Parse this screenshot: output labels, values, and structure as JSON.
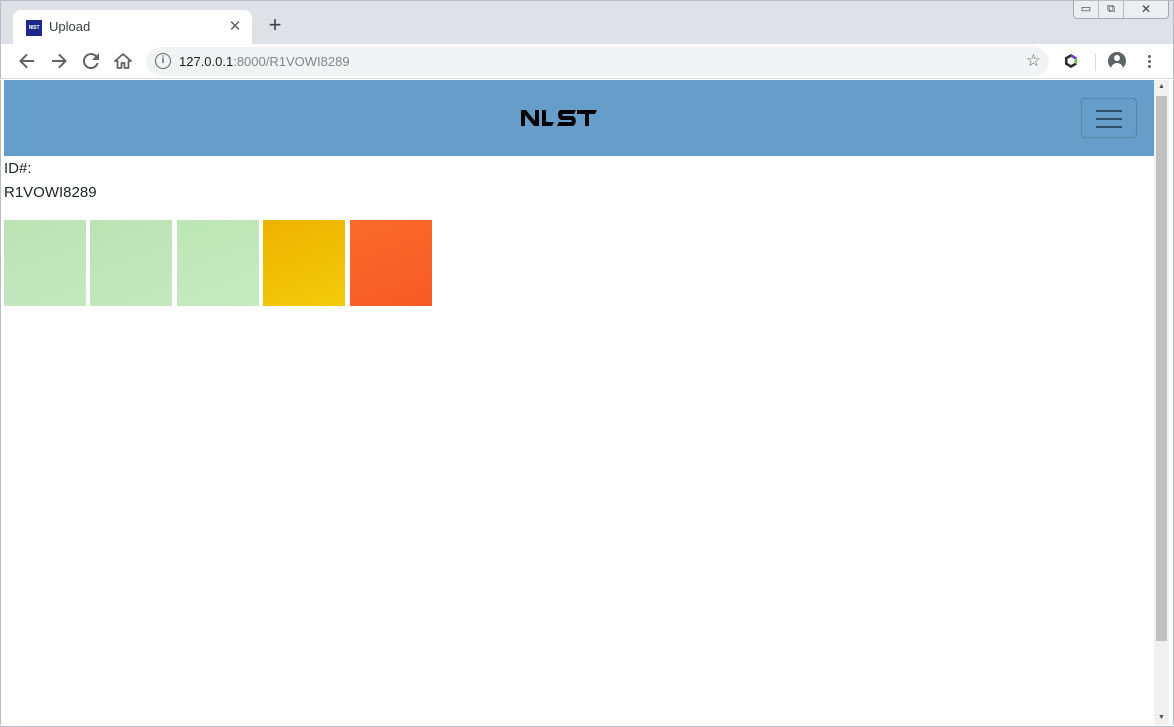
{
  "browser": {
    "tab": {
      "title": "Upload",
      "favicon_text": "NIST"
    },
    "new_tab_symbol": "+",
    "close_tab_symbol": "✕",
    "window_controls": {
      "minimize": "▭",
      "restore": "⧉",
      "close": "✕"
    },
    "address_bar": {
      "host": "127.0.0.1",
      "path": ":8000/R1VOWI8289"
    },
    "icons": [
      "back-icon",
      "forward-icon",
      "reload-icon",
      "home-icon",
      "site-info-icon",
      "bookmark-star-icon",
      "extension-icon",
      "profile-icon",
      "menu-icon"
    ]
  },
  "page": {
    "header": {
      "logo_text": "NIST",
      "background_color": "#669ec9"
    },
    "id_label": "ID#:",
    "id_value": "R1VOWI8289",
    "swatches": [
      {
        "color": "#c5e8bf",
        "shade": "#bbe3b4"
      },
      {
        "color": "#c5e8bf",
        "shade": "#bbe3b4"
      },
      {
        "color": "#c6ebc0",
        "shade": "#bde6b6"
      },
      {
        "color": "#f2cc0a",
        "shade": "#eeb200"
      },
      {
        "color": "#f55b24",
        "shade": "#fb6a2c"
      }
    ]
  }
}
